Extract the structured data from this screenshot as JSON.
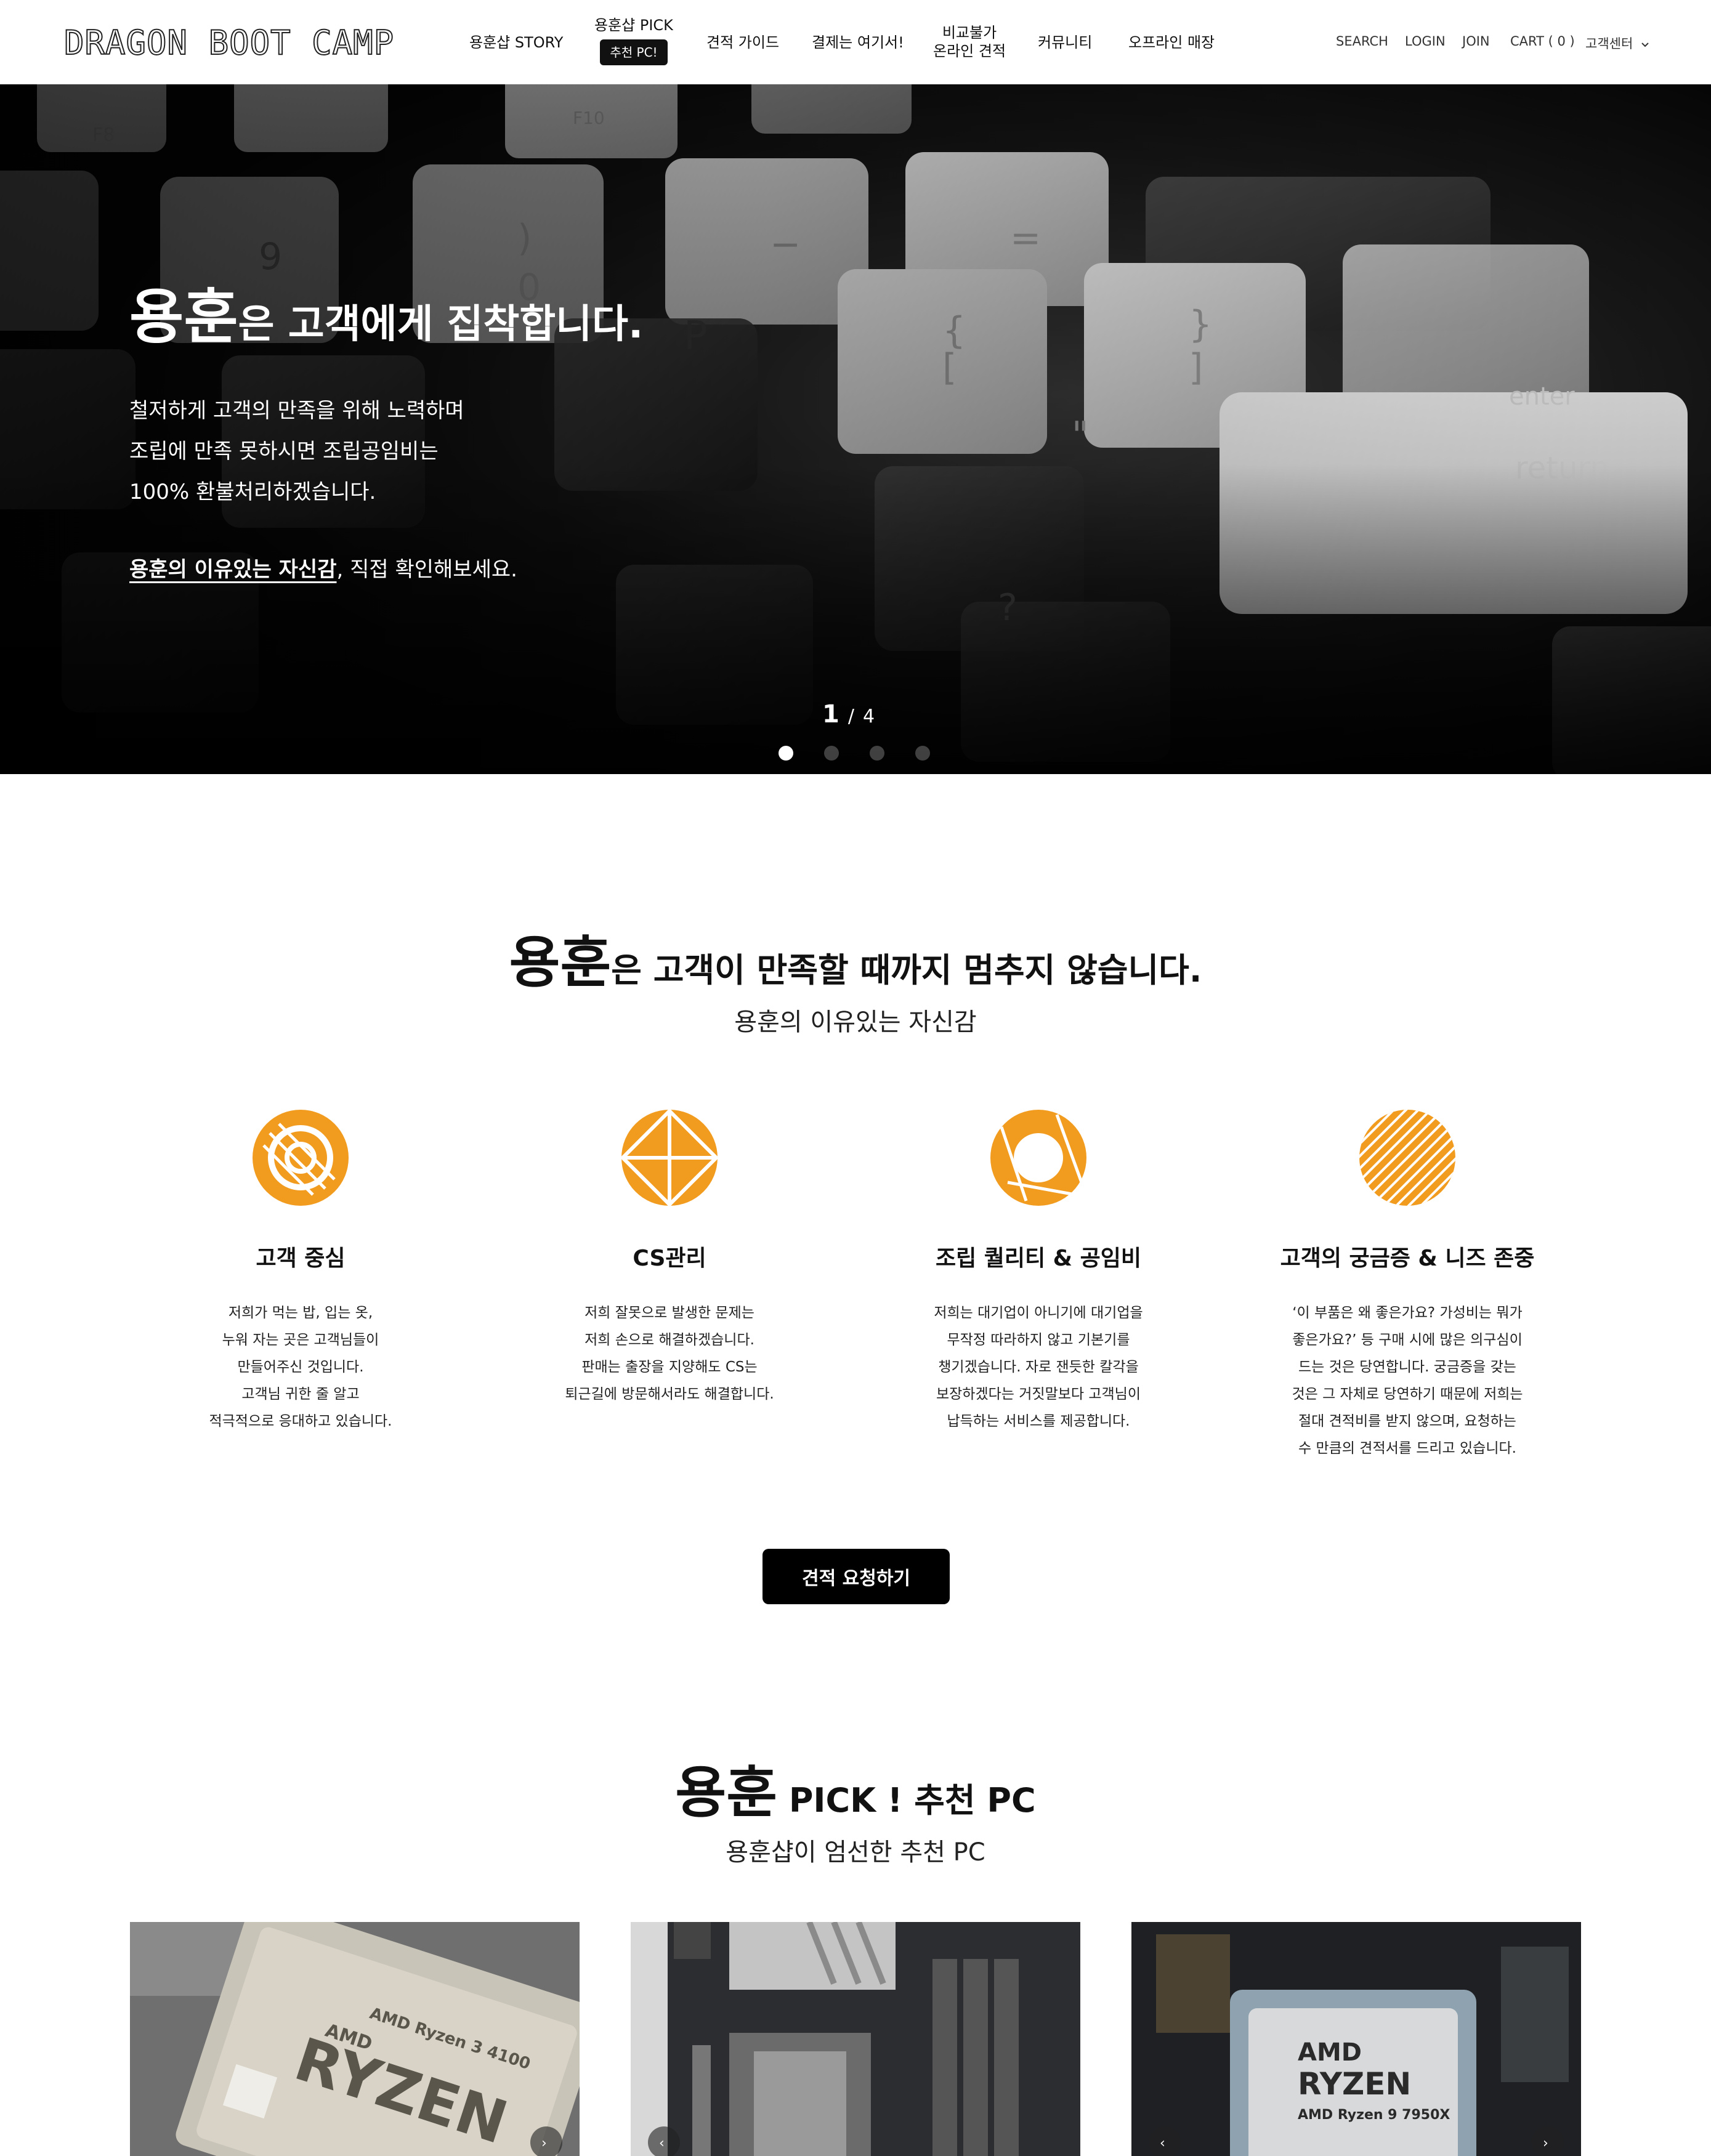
{
  "header": {
    "logo": "DRAGON BOOT CAMP",
    "nav": [
      {
        "label": "용훈샵 STORY"
      },
      {
        "label": "용훈샵 PICK",
        "badge": "추천 PC!"
      },
      {
        "label": "견적 가이드"
      },
      {
        "label": "결제는 여기서!"
      },
      {
        "label_line1": "비교불가",
        "label_line2": "온라인 견적"
      },
      {
        "label": "커뮤니티"
      },
      {
        "label": "오프라인 매장"
      }
    ],
    "utility": {
      "search": "SEARCH",
      "login": "LOGIN",
      "join": "JOIN",
      "cart": "CART",
      "cart_count": "( 0 )",
      "customer_center": "고객센터"
    }
  },
  "hero": {
    "brand": "용훈",
    "title_rest": "은 고객에게 집착합니다.",
    "desc": [
      "철저하게 고객의 만족을 위해 노력하며",
      "조립에 만족 못하시면 조립공임비는",
      "100% 환불처리하겠습니다."
    ],
    "cta_underlined": "용훈의 이유있는 자신감",
    "cta_rest": ", 직접 확인해보세요.",
    "slide_current": "1",
    "slide_separator": "/",
    "slide_total": "4",
    "active_slide_index": 0,
    "slide_count": 4
  },
  "satisfaction": {
    "brand": "용훈",
    "title_rest": "은 고객이 만족할 때까지 멈추지 않습니다.",
    "subtitle": "용훈의 이유있는 자신감",
    "accent_color": "#f29c1f",
    "features": [
      {
        "icon": "circle-target-icon",
        "title": "고객 중심",
        "lines": [
          "저희가 먹는 밥, 입는 옷,",
          "누워 자는 곳은 고객님들이",
          "만들어주신 것입니다.",
          "고객님 귀한 줄 알고",
          "적극적으로 응대하고 있습니다."
        ]
      },
      {
        "icon": "circle-diamond-icon",
        "title": "CS관리",
        "lines": [
          "저희 잘못으로 발생한 문제는",
          "저희 손으로 해결하겠습니다.",
          "판매는 출장을 지양해도 CS는",
          "퇴근길에 방문해서라도 해결합니다."
        ]
      },
      {
        "icon": "ring-icon",
        "title": "조립 퀄리티 & 공임비",
        "lines": [
          "저희는 대기업이 아니기에 대기업을",
          "무작정 따라하지 않고 기본기를",
          "챙기겠습니다. 자로 잰듯한 칼각을",
          "보장하겠다는 거짓말보다 고객님이",
          "납득하는 서비스를 제공합니다."
        ]
      },
      {
        "icon": "striped-circle-icon",
        "title": "고객의 궁금증 & 니즈 존중",
        "lines": [
          "‘이 부품은 왜 좋은가요? 가성비는 뭐가",
          "좋은가요?’ 등 구매 시에 많은 의구심이",
          "드는 것은 당연합니다. 궁금증을 갖는",
          "것은 그 자체로 당연하기 때문에 저희는",
          "절대 견적비를 받지 않으며, 요청하는",
          "수 만큼의 견적서를 드리고 있습니다."
        ]
      }
    ],
    "button": "견적 요청하기"
  },
  "pick": {
    "brand": "용훈",
    "title_rest": " PICK ! 추천 PC",
    "subtitle": "용훈샵이 엄선한 추천 PC",
    "cards": [
      {
        "image": "amd-ryzen-3-4100-cpu-photo",
        "chip_line1": "AMD Ryzen 3 4100",
        "chip_line2": "AMD",
        "chip_line3": "RYZEN"
      },
      {
        "image": "motherboard-socket-photo"
      },
      {
        "image": "amd-ryzen-9-7950x-cpu-photo",
        "chip_line1": "AMD",
        "chip_line2": "RYZEN",
        "chip_line3": "AMD Ryzen 9 7950X"
      }
    ]
  }
}
